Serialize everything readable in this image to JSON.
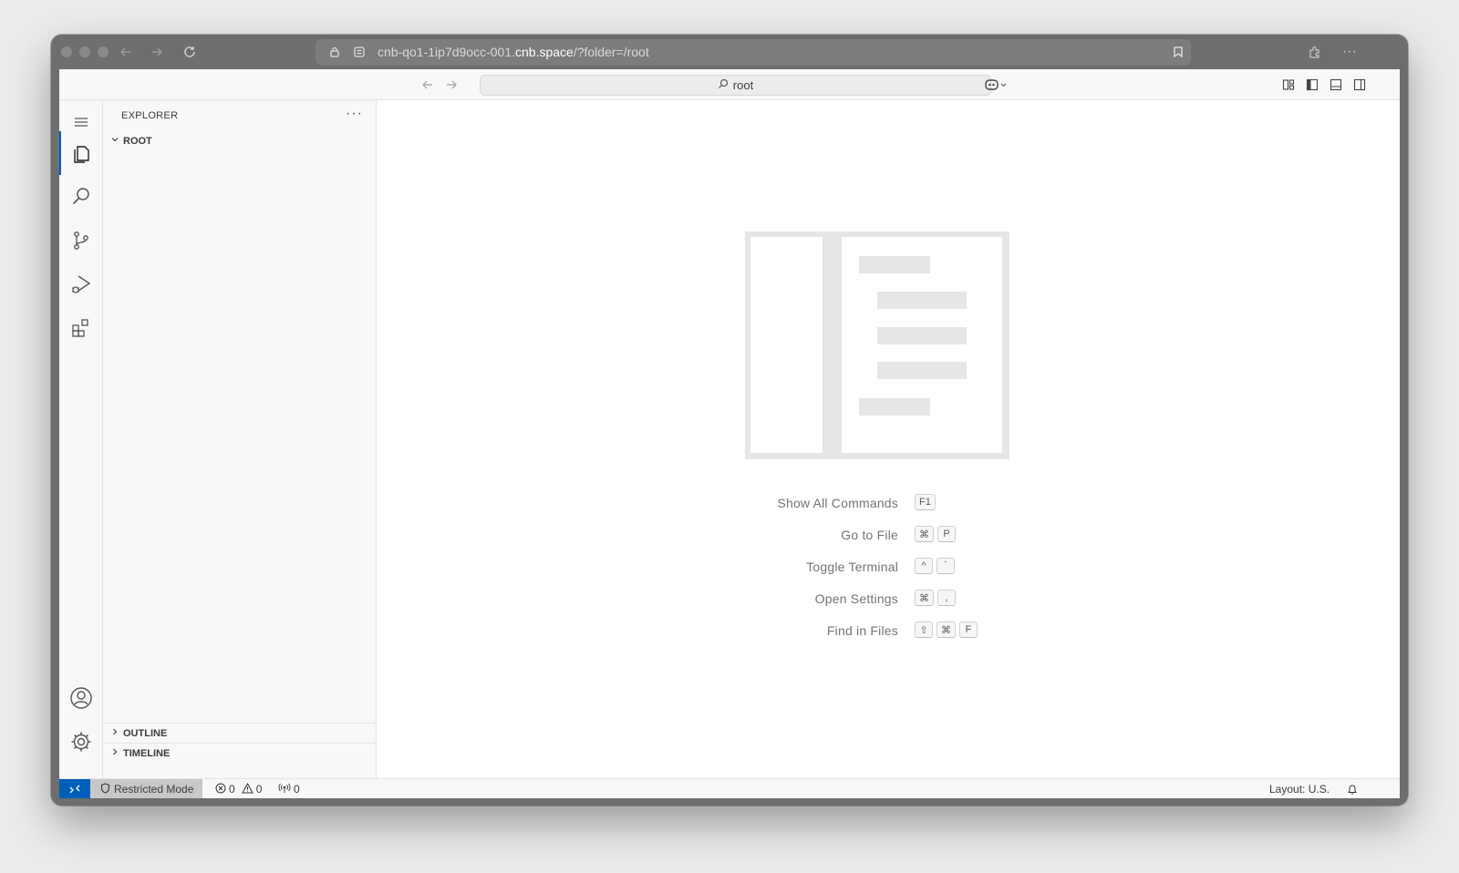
{
  "browser": {
    "url_prefix": "cnb-qo1-1ip7d9occ-001.",
    "url_host": "cnb.space",
    "url_suffix": "/?folder=/root"
  },
  "titlebar": {
    "command_center": "root"
  },
  "activity_bar": {
    "items": [
      "explorer-icon",
      "search-icon",
      "source-control-icon",
      "run-debug-icon",
      "extensions-icon"
    ],
    "bottom": [
      "accounts-icon",
      "manage-gear-icon"
    ]
  },
  "sidebar": {
    "title": "EXPLORER",
    "more": "···",
    "root_folder": "ROOT",
    "sections": [
      "OUTLINE",
      "TIMELINE"
    ]
  },
  "editor": {
    "shortcuts": [
      {
        "label": "Show All Commands",
        "keys": [
          "F1"
        ]
      },
      {
        "label": "Go to File",
        "keys": [
          "⌘",
          "P"
        ]
      },
      {
        "label": "Toggle Terminal",
        "keys": [
          "^",
          "`"
        ]
      },
      {
        "label": "Open Settings",
        "keys": [
          "⌘",
          ","
        ]
      },
      {
        "label": "Find in Files",
        "keys": [
          "⇧",
          "⌘",
          "F"
        ]
      }
    ]
  },
  "statusbar": {
    "remote_icon": "remote-icon",
    "restricted": "Restricted Mode",
    "errors": "0",
    "warnings": "0",
    "ports": "0",
    "layout": "Layout: U.S.",
    "accent": "#005fb8"
  }
}
